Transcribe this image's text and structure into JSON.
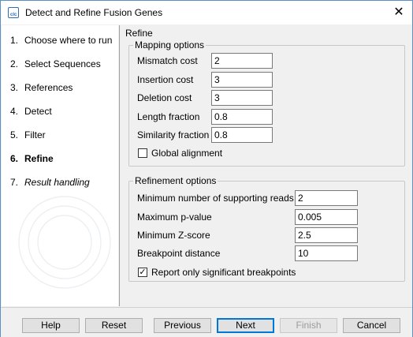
{
  "window": {
    "title": "Detect and Refine Fusion Genes"
  },
  "steps": [
    {
      "num": "1.",
      "label": "Choose where to run"
    },
    {
      "num": "2.",
      "label": "Select Sequences"
    },
    {
      "num": "3.",
      "label": "References"
    },
    {
      "num": "4.",
      "label": "Detect"
    },
    {
      "num": "5.",
      "label": "Filter"
    },
    {
      "num": "6.",
      "label": "Refine"
    },
    {
      "num": "7.",
      "label": "Result handling"
    }
  ],
  "panel": {
    "title": "Refine",
    "mapping": {
      "label": "Mapping options",
      "mismatch_cost": {
        "label": "Mismatch cost",
        "value": "2"
      },
      "insertion_cost": {
        "label": "Insertion cost",
        "value": "3"
      },
      "deletion_cost": {
        "label": "Deletion cost",
        "value": "3"
      },
      "length_fraction": {
        "label": "Length fraction",
        "value": "0.8"
      },
      "similarity_fraction": {
        "label": "Similarity fraction",
        "value": "0.8"
      },
      "global_alignment": {
        "label": "Global alignment",
        "checked": false,
        "mark": ""
      }
    },
    "refinement": {
      "label": "Refinement options",
      "min_supporting_reads": {
        "label": "Minimum number of supporting reads",
        "value": "2"
      },
      "max_p_value": {
        "label": "Maximum p-value",
        "value": "0.005"
      },
      "min_z_score": {
        "label": "Minimum Z-score",
        "value": "2.5"
      },
      "breakpoint_distance": {
        "label": "Breakpoint distance",
        "value": "10"
      },
      "report_significant": {
        "label": "Report only significant breakpoints",
        "checked": true,
        "mark": "✓"
      }
    }
  },
  "buttons": {
    "help": "Help",
    "reset": "Reset",
    "previous": "Previous",
    "next": "Next",
    "finish": "Finish",
    "cancel": "Cancel"
  },
  "colors": {
    "accent": "#0078d7",
    "window_border": "#5a8fc8"
  }
}
